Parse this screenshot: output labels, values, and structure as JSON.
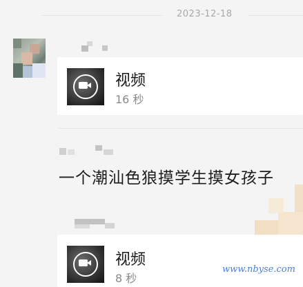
{
  "chat": {
    "date_separator": "2023-12-18",
    "messages": [
      {
        "type": "video",
        "title": "视频",
        "duration": "16 秒"
      },
      {
        "type": "text",
        "text": "一个潮汕色狼摸学生摸女孩子"
      },
      {
        "type": "video",
        "title": "视频",
        "duration": "8 秒"
      }
    ]
  },
  "watermark": "www.nbyse.com",
  "icons": {
    "video": "video-camera-icon"
  },
  "colors": {
    "background": "#f4f4f4",
    "card": "#ffffff",
    "watermark": "#4a7fd0"
  }
}
